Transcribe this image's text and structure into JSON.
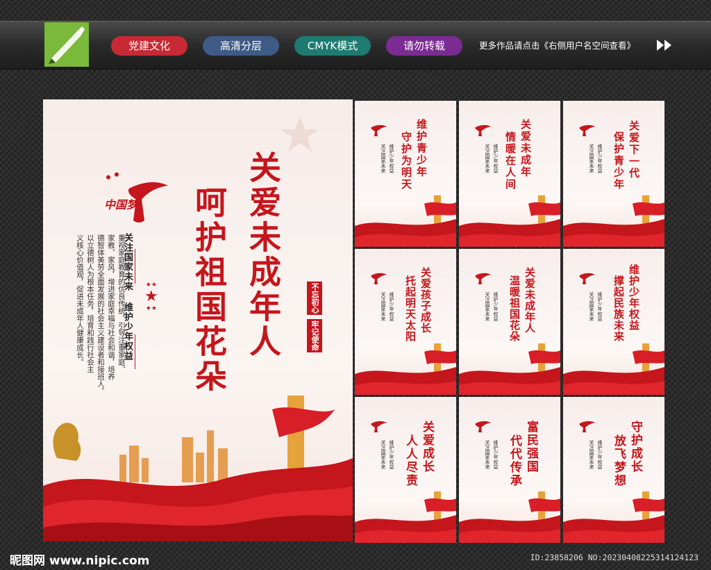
{
  "toolbar": {
    "tags": [
      {
        "label": "党建文化",
        "color": "#c72a35"
      },
      {
        "label": "高清分层",
        "color": "#3d5b86"
      },
      {
        "label": "CMYK模式",
        "color": "#1d7b71"
      },
      {
        "label": "请勿转载",
        "color": "#7b2c93"
      }
    ],
    "more_text": "更多作品请点击《右侧用户名空间查看》"
  },
  "main_poster": {
    "logo_text": "中国梦",
    "headline_right": "关爱未成年人",
    "headline_left": "呵护祖国花朵",
    "side_label_1": "不忘初心",
    "side_label_2": "牢记使命",
    "subtitle_1": "关注国家未来",
    "subtitle_2": "维护少年权益",
    "body_lines": [
      "重视家庭教育的优良传统，引导注重家庭、",
      "家教、家风，增进家庭幸福与社会和谐，培养",
      "德智体美劳全面发展的社会主义建设者和接班人，",
      "以立德树人为根本任务，培育和践行社会主",
      "义核心价值观，促进未成年人健康成长。"
    ]
  },
  "panels": [
    {
      "line1": "维护青少年",
      "line2": "守护为明天"
    },
    {
      "line1": "关爱未成年",
      "line2": "情暖在人间"
    },
    {
      "line1": "关爱下一代",
      "line2": "保护青少年"
    },
    {
      "line1": "关爱孩子成长",
      "line2": "托起明天太阳"
    },
    {
      "line1": "关爱未成年人",
      "line2": "温暖祖国花朵"
    },
    {
      "line1": "维护少年权益",
      "line2": "撑起民族未来"
    },
    {
      "line1": "关爱成长",
      "line2": "人人尽责"
    },
    {
      "line1": "富民强国",
      "line2": "代代传承"
    },
    {
      "line1": "守护成长",
      "line2": "放飞梦想"
    }
  ],
  "panel_small_text": {
    "sub_1": "关注国家未来",
    "sub_2": "维护少年权益",
    "logo": "中国梦"
  },
  "footer": {
    "site": "昵图网 www.nipic.com",
    "id_text": "ID:23858206 NO:20230408225314124123"
  }
}
